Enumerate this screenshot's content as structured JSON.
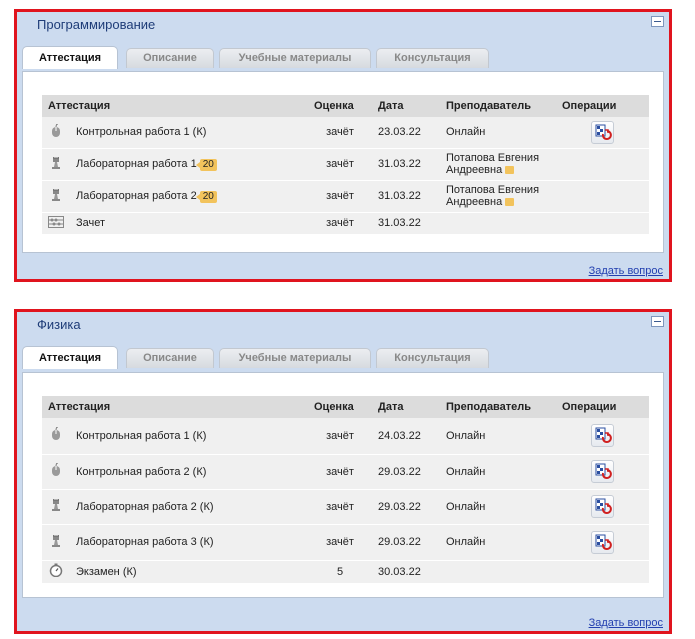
{
  "panels": [
    {
      "title": "Программирование",
      "tabs": [
        "Аттестация",
        "Описание",
        "Учебные материалы",
        "Консультация"
      ],
      "headers": [
        "Аттестация",
        "Оценка",
        "Дата",
        "Преподаватель",
        "Операции"
      ],
      "rows": [
        {
          "icon": "mouse-icon",
          "name": "Контрольная работа 1 (К)",
          "badge": "",
          "grade": "зачёт",
          "date": "23.03.22",
          "teacher_line1": "Онлайн",
          "teacher_line2": "",
          "has_op": true
        },
        {
          "icon": "chess-piece-icon",
          "name": "Лабораторная работа 1",
          "badge": "20",
          "grade": "зачёт",
          "date": "31.03.22",
          "teacher_line1": "Потапова Евгения",
          "teacher_line2": "Андреевна",
          "has_op": false
        },
        {
          "icon": "chess-piece-icon",
          "name": "Лабораторная работа 2",
          "badge": "20",
          "grade": "зачёт",
          "date": "31.03.22",
          "teacher_line1": "Потапова Евгения",
          "teacher_line2": "Андреевна",
          "has_op": false
        },
        {
          "icon": "abacus-icon",
          "name": "Зачет",
          "badge": "",
          "grade": "зачёт",
          "date": "31.03.22",
          "teacher_line1": "",
          "teacher_line2": "",
          "has_op": false
        }
      ],
      "ask_link": "Задать вопрос"
    },
    {
      "title": "Физика",
      "tabs": [
        "Аттестация",
        "Описание",
        "Учебные материалы",
        "Консультация"
      ],
      "headers": [
        "Аттестация",
        "Оценка",
        "Дата",
        "Преподаватель",
        "Операции"
      ],
      "rows": [
        {
          "icon": "mouse-icon",
          "name": "Контрольная работа 1 (К)",
          "badge": "",
          "grade": "зачёт",
          "date": "24.03.22",
          "teacher_line1": "Онлайн",
          "teacher_line2": "",
          "has_op": true
        },
        {
          "icon": "mouse-icon",
          "name": "Контрольная работа 2 (К)",
          "badge": "",
          "grade": "зачёт",
          "date": "29.03.22",
          "teacher_line1": "Онлайн",
          "teacher_line2": "",
          "has_op": true
        },
        {
          "icon": "chess-piece-icon",
          "name": "Лабораторная работа 2 (К)",
          "badge": "",
          "grade": "зачёт",
          "date": "29.03.22",
          "teacher_line1": "Онлайн",
          "teacher_line2": "",
          "has_op": true
        },
        {
          "icon": "chess-piece-icon",
          "name": "Лабораторная работа 3 (К)",
          "badge": "",
          "grade": "зачёт",
          "date": "29.03.22",
          "teacher_line1": "Онлайн",
          "teacher_line2": "",
          "has_op": true
        },
        {
          "icon": "stopwatch-icon",
          "name": "Экзамен (К)",
          "badge": "",
          "grade": "5",
          "date": "30.03.22",
          "teacher_line1": "",
          "teacher_line2": "",
          "has_op": false
        }
      ],
      "ask_link": "Задать вопрос"
    }
  ],
  "colors": {
    "panel_border": "#e0141e",
    "panel_bg": "#ccdbef",
    "title": "#1e3c78",
    "link": "#2440b0",
    "badge": "#f2c35c"
  }
}
